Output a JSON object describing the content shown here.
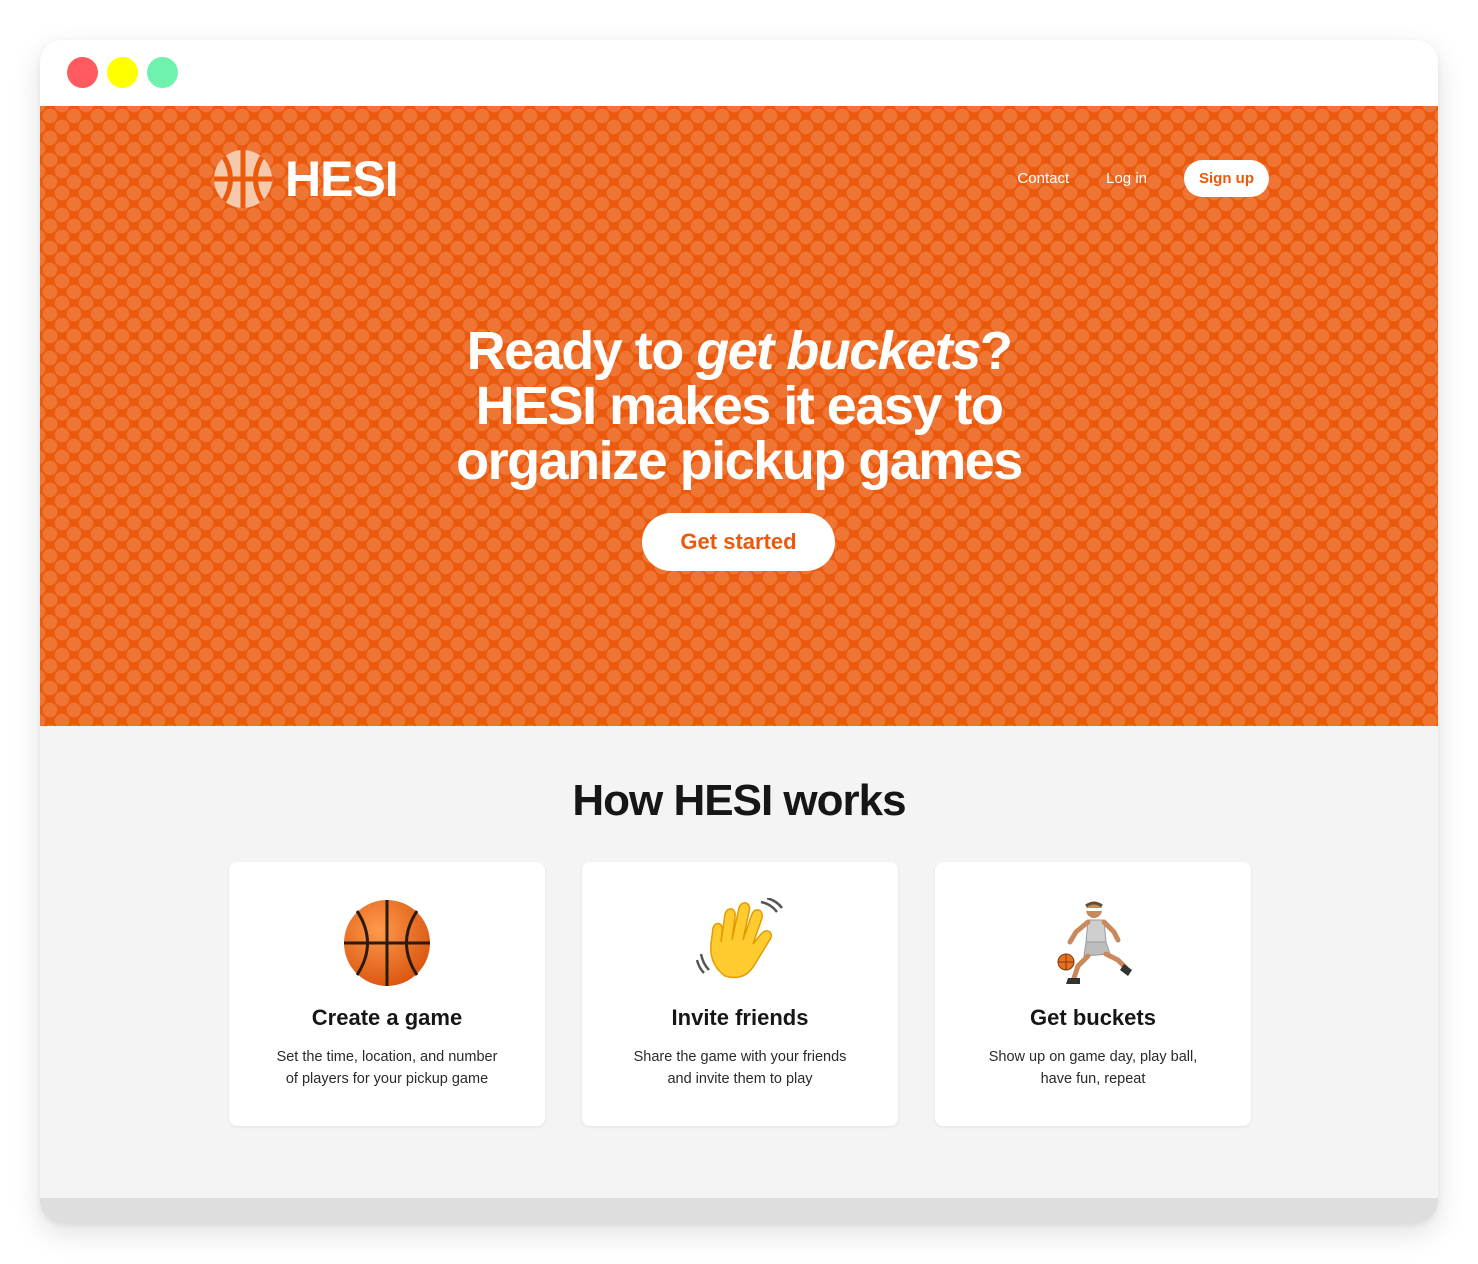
{
  "brand": {
    "name": "HESI",
    "primary_color": "#eb5a0c",
    "logo_icon": "basketball-icon"
  },
  "nav": {
    "contact": "Contact",
    "login": "Log in",
    "signup": "Sign up"
  },
  "hero": {
    "line1_before": "Ready to ",
    "line1_emphasis": "get buckets",
    "line1_after": "?",
    "line2": "HESI makes it easy to",
    "line3": "organize pickup games",
    "cta": "Get started"
  },
  "how": {
    "title": "How HESI works",
    "cards": [
      {
        "icon": "basketball-icon",
        "title": "Create a game",
        "line1": "Set the time, location, and number",
        "line2": "of players for your pickup game"
      },
      {
        "icon": "waving-hand-icon",
        "title": "Invite friends",
        "line1": "Share the game with your friends",
        "line2": "and invite them to play"
      },
      {
        "icon": "basketball-player-icon",
        "title": "Get buckets",
        "line1": "Show up on game day, play ball,",
        "line2": "have fun, repeat"
      }
    ]
  }
}
